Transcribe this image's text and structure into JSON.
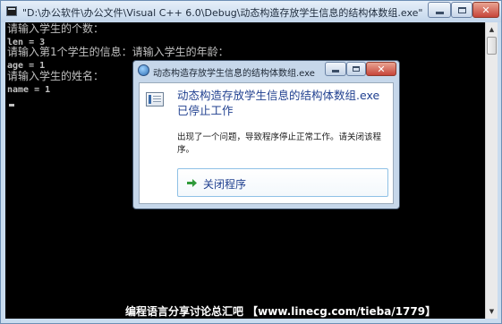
{
  "console_window": {
    "title": "\"D:\\办公软件\\办公文件\\Visual C++ 6.0\\Debug\\动态构造存放学生信息的结构体数组.exe\"",
    "lines": [
      "请输入学生的个数：",
      "len = 3",
      "请输入第1个学生的信息：请输入学生的年龄：",
      "age = 1",
      "请输入学生的姓名：",
      "name = 1"
    ]
  },
  "dialog": {
    "title": "动态构造存放学生信息的结构体数组.exe",
    "heading": "动态构造存放学生信息的结构体数组.exe 已停止工作",
    "message": "出现了一个问题，导致程序停止正常工作。请关闭该程序。",
    "close_program_label": "关闭程序"
  },
  "watermark": "编程语言分享讨论总汇吧 【www.linecg.com/tieba/1779】",
  "icons": {
    "console_app": "console-app-icon",
    "dialog_title": "program-icon",
    "dialog_body": "application-icon",
    "close_arrow": "green-arrow-icon"
  },
  "colors": {
    "console_bg": "#000000",
    "console_text": "#c0c0c0",
    "dialog_heading": "#1f3f8f",
    "close_button": "#c7453a",
    "arrow": "#2f9a3a"
  }
}
